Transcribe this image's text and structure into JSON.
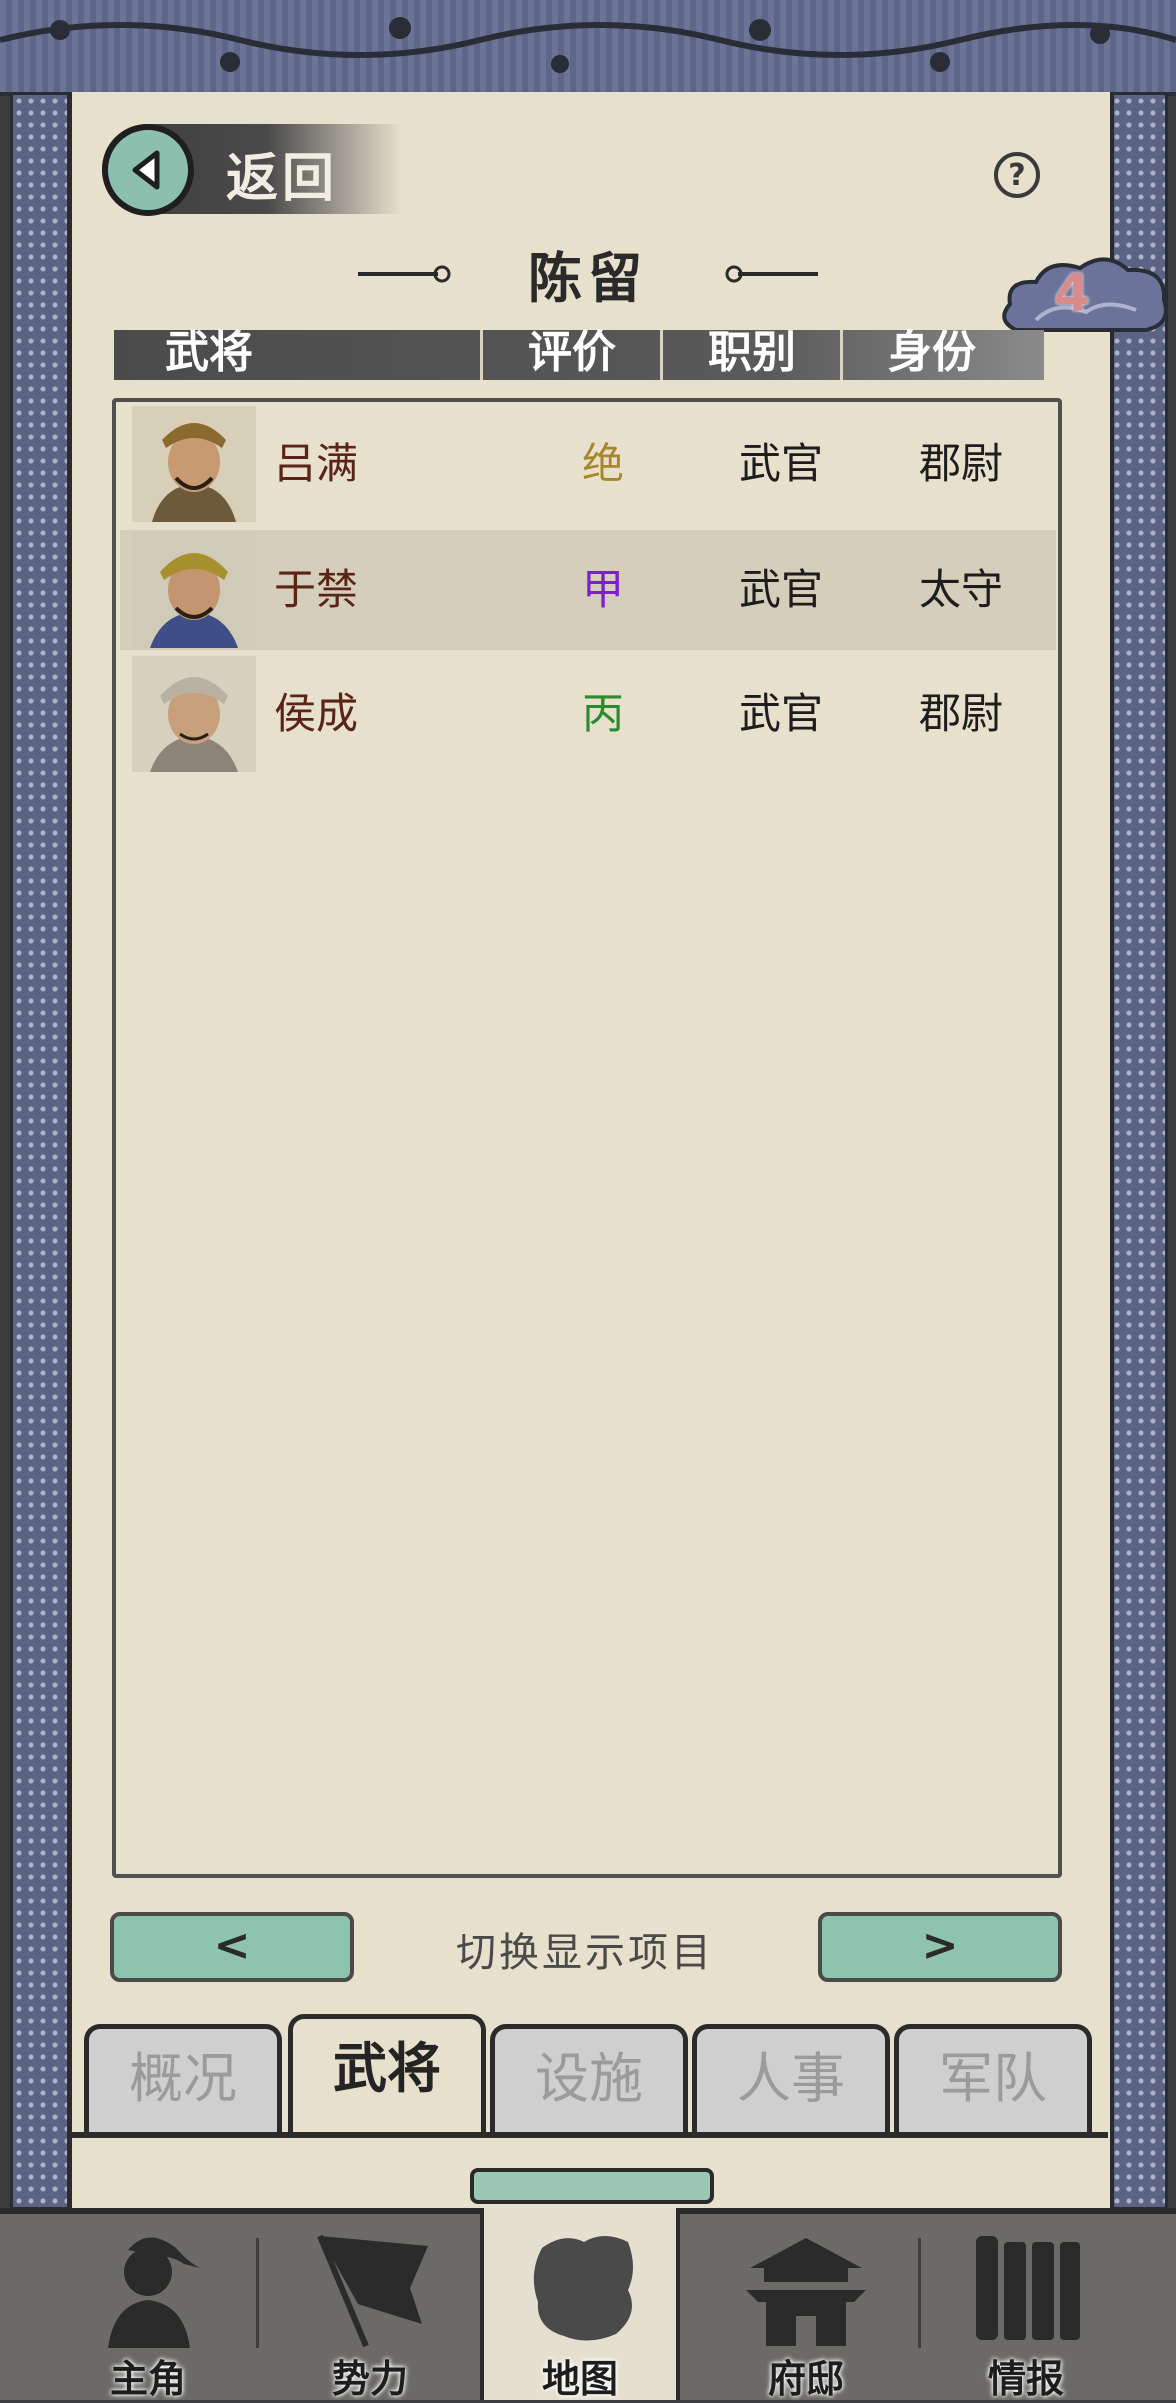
{
  "header": {
    "back_label": "返回",
    "help_label": "?",
    "city_name": "陈留",
    "badge_count": "4"
  },
  "table": {
    "columns": [
      "武将",
      "评价",
      "职别",
      "身份"
    ],
    "rows": [
      {
        "name": "吕满",
        "grade": "绝",
        "grade_color": "#a8862e",
        "job": "武官",
        "rank": "郡尉"
      },
      {
        "name": "于禁",
        "grade": "甲",
        "grade_color": "#7a1fd6",
        "job": "武官",
        "rank": "太守"
      },
      {
        "name": "侯成",
        "grade": "丙",
        "grade_color": "#2e8a2e",
        "job": "武官",
        "rank": "郡尉"
      }
    ]
  },
  "pager": {
    "prev_label": "<",
    "next_label": ">",
    "label": "切换显示项目"
  },
  "tabs": [
    {
      "label": "概况",
      "active": false
    },
    {
      "label": "武将",
      "active": true
    },
    {
      "label": "设施",
      "active": false
    },
    {
      "label": "人事",
      "active": false
    },
    {
      "label": "军队",
      "active": false
    }
  ],
  "bottom_nav": [
    {
      "label": "主角",
      "icon": "character-icon",
      "active": false
    },
    {
      "label": "势力",
      "icon": "flag-icon",
      "active": false
    },
    {
      "label": "地图",
      "icon": "map-icon",
      "active": true
    },
    {
      "label": "府邸",
      "icon": "mansion-icon",
      "active": false
    },
    {
      "label": "情报",
      "icon": "scroll-icon",
      "active": false
    }
  ]
}
